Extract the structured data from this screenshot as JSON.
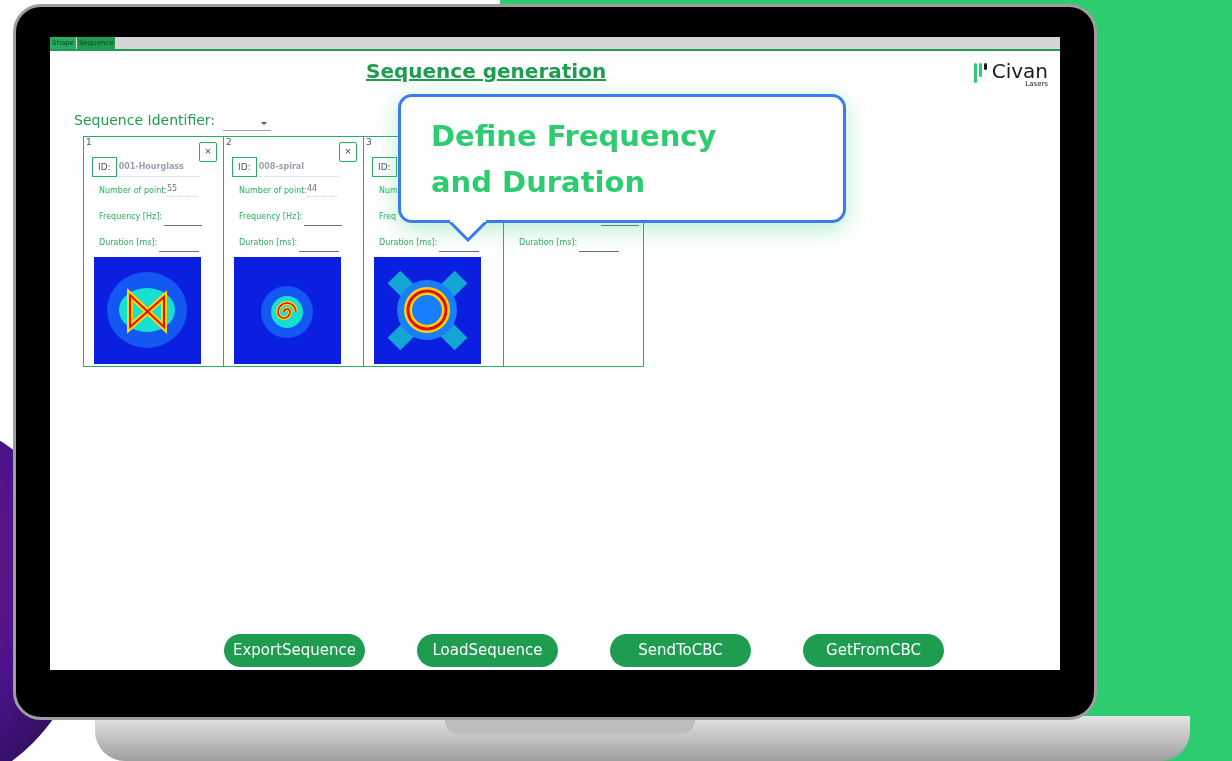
{
  "tabs": [
    {
      "label": "Shape",
      "selected": false
    },
    {
      "label": "Sequence",
      "selected": true
    }
  ],
  "title": "Sequence generation",
  "logo": {
    "name": "Civan",
    "subtitle": "Lasers"
  },
  "sequence_identifier": {
    "label": "Sequence Identifier:"
  },
  "cards": [
    {
      "index": "1",
      "id_label": "ID:",
      "id_value": "001-Hourglass",
      "points_label": "Number of point:",
      "points_value": "55",
      "frequency_label": "Frequency [Hz]:",
      "duration_label": "Duration [ms]:",
      "close": "×",
      "kind": "hourglass"
    },
    {
      "index": "2",
      "id_label": "ID:",
      "id_value": "008-spiral",
      "points_label": "Number of point:",
      "points_value": "44",
      "frequency_label": "Frequency [Hz]:",
      "duration_label": "Duration [ms]:",
      "close": "×",
      "kind": "spiral"
    },
    {
      "index": "3",
      "id_label": "ID:",
      "points_label": "Num",
      "frequency_label": "Freq",
      "duration_label": "Duration [ms]:",
      "kind": "ring"
    },
    {
      "duration_label": "Duration [ms]:"
    }
  ],
  "callout": {
    "lines": [
      "Define Frequency",
      "and Duration"
    ]
  },
  "buttons": [
    "ExportSequence",
    "LoadSequence",
    "SendToCBC",
    "GetFromCBC"
  ]
}
